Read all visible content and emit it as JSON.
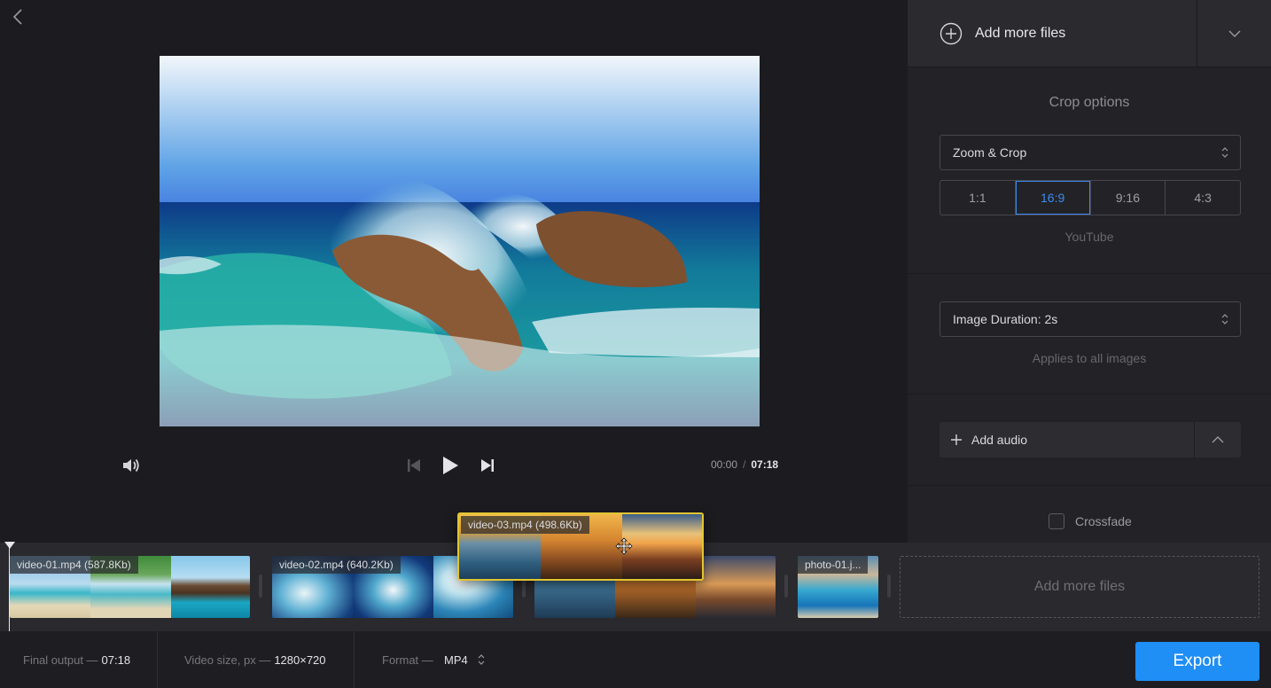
{
  "panel": {
    "add_files_label": "Add more files",
    "crop_title": "Crop options",
    "crop_mode": "Zoom & Crop",
    "ratios": [
      "1:1",
      "16:9",
      "9:16",
      "4:3"
    ],
    "active_ratio": "16:9",
    "ratio_hint": "YouTube",
    "image_duration": "Image Duration: 2s",
    "duration_hint": "Applies to all images",
    "add_audio_label": "Add audio",
    "crossfade_label": "Crossfade",
    "crossfade_checked": false
  },
  "player": {
    "current_time": "00:00",
    "separator": "/",
    "total_time": "07:18"
  },
  "timeline": {
    "clips": [
      {
        "label": "video-01.mp4 (587.8Kb)"
      },
      {
        "label": "video-02.mp4 (640.2Kb)"
      },
      {
        "label": ""
      },
      {
        "label": "photo-01.j..."
      }
    ],
    "dragging_clip": {
      "label": "video-03.mp4 (498.6Kb)"
    },
    "add_more_label": "Add more files"
  },
  "footer": {
    "final_output_label": "Final output —",
    "final_output_value": "07:18",
    "video_size_label": "Video size, px —",
    "video_size_value": "1280×720",
    "format_label": "Format —",
    "format_value": "MP4",
    "export_label": "Export"
  },
  "colors": {
    "accent": "#1f8ef5",
    "active_ratio": "#3b8bf0",
    "drag_border": "#e2c531"
  }
}
